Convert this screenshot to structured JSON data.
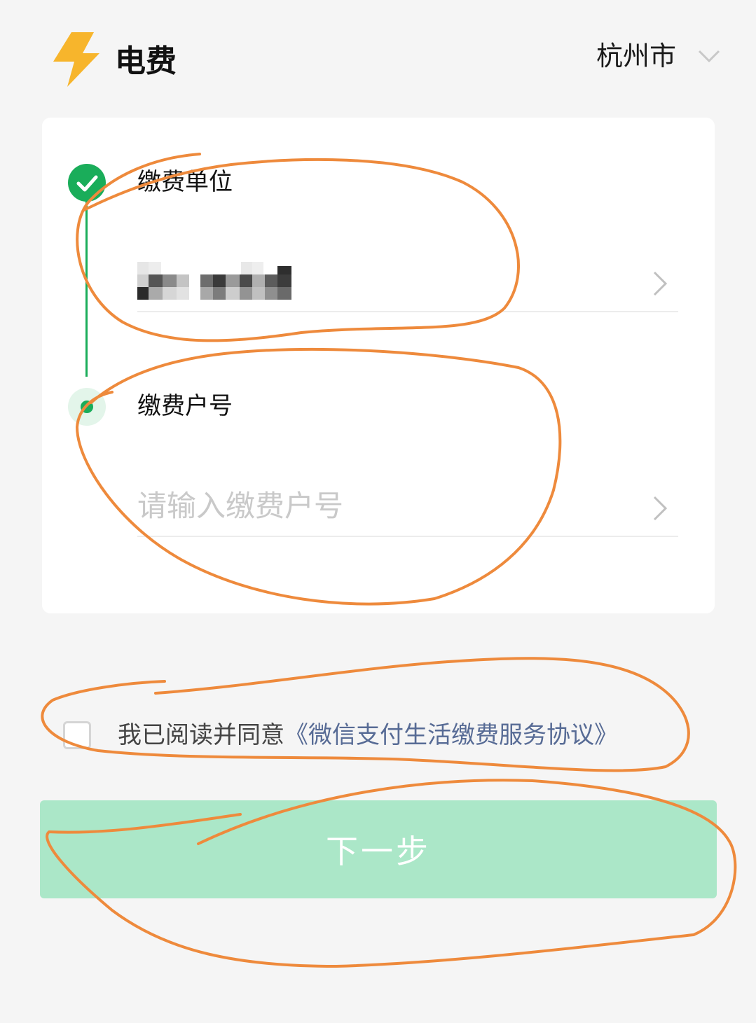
{
  "header": {
    "title": "电费",
    "city": "杭州市",
    "bolt_color": "#f7b52c"
  },
  "steps": [
    {
      "label": "缴费单位",
      "value_obscured": true,
      "status": "done"
    },
    {
      "label": "缴费户号",
      "placeholder": "请输入缴费户号",
      "status": "current"
    }
  ],
  "agreement": {
    "checked": false,
    "text": "我已阅读并同意",
    "link": "《微信支付生活缴费服务协议》"
  },
  "next_button": {
    "label": "下一步",
    "enabled": false,
    "color": "#abe7c8"
  },
  "colors": {
    "accent_green": "#1aad5a",
    "link": "#576b95",
    "annotation_orange": "#ee8a3c"
  }
}
